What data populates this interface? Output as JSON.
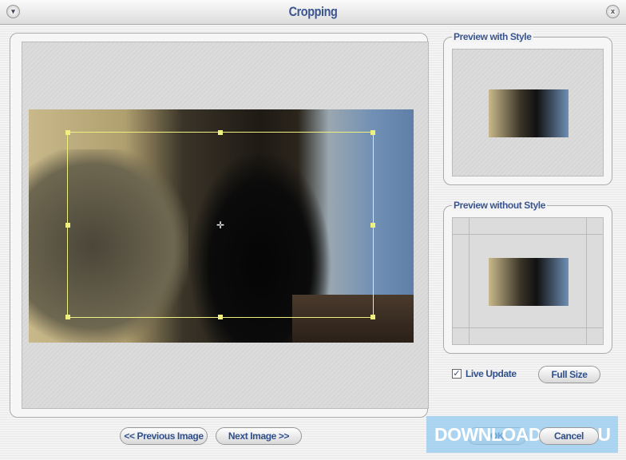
{
  "window": {
    "title": "Cropping",
    "menu_icon": "chevron-down-icon",
    "close_icon": "close-icon"
  },
  "preview_with_style": {
    "label": "Preview with Style"
  },
  "preview_without_style": {
    "label": "Preview without Style"
  },
  "live_update": {
    "label": "Live Update",
    "checked": true
  },
  "buttons": {
    "full_size": "Full Size",
    "previous": "<< Previous Image",
    "next": "Next Image >>",
    "ok": "OK",
    "cancel": "Cancel"
  },
  "watermark": "DOWNLOADS GURU"
}
